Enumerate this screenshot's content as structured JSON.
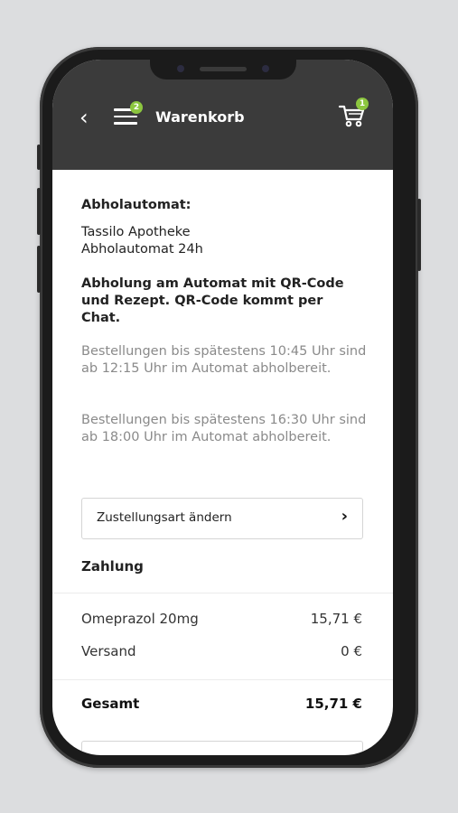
{
  "header": {
    "back_icon": "back-arrow-icon",
    "menu_badge": "2",
    "title": "Warenkorb",
    "cart_badge": "1"
  },
  "pickup": {
    "heading": "Abholautomat:",
    "name_line1": "Tassilo Apotheke",
    "name_line2": "Abholautomat 24h",
    "notice": "Abholung am Automat mit QR-Code und Rezept. QR-Code kommt per Chat.",
    "schedule1": "Bestellungen bis spätestens 10:45 Uhr sind ab 12:15 Uhr im Automat abholbereit.",
    "schedule2": "Bestellungen bis spätestens 16:30 Uhr sind ab 18:00 Uhr im Automat abholbereit."
  },
  "change_delivery_label": "Zustellungsart ändern",
  "payment": {
    "heading": "Zahlung",
    "items": [
      {
        "label": "Omeprazol 20mg",
        "value": "15,71 €"
      },
      {
        "label": "Versand",
        "value": "0 €"
      }
    ],
    "total_label": "Gesamt",
    "total_value": "15,71 €"
  },
  "colors": {
    "header_bg": "#3b3b3b",
    "badge": "#8cc63f"
  }
}
